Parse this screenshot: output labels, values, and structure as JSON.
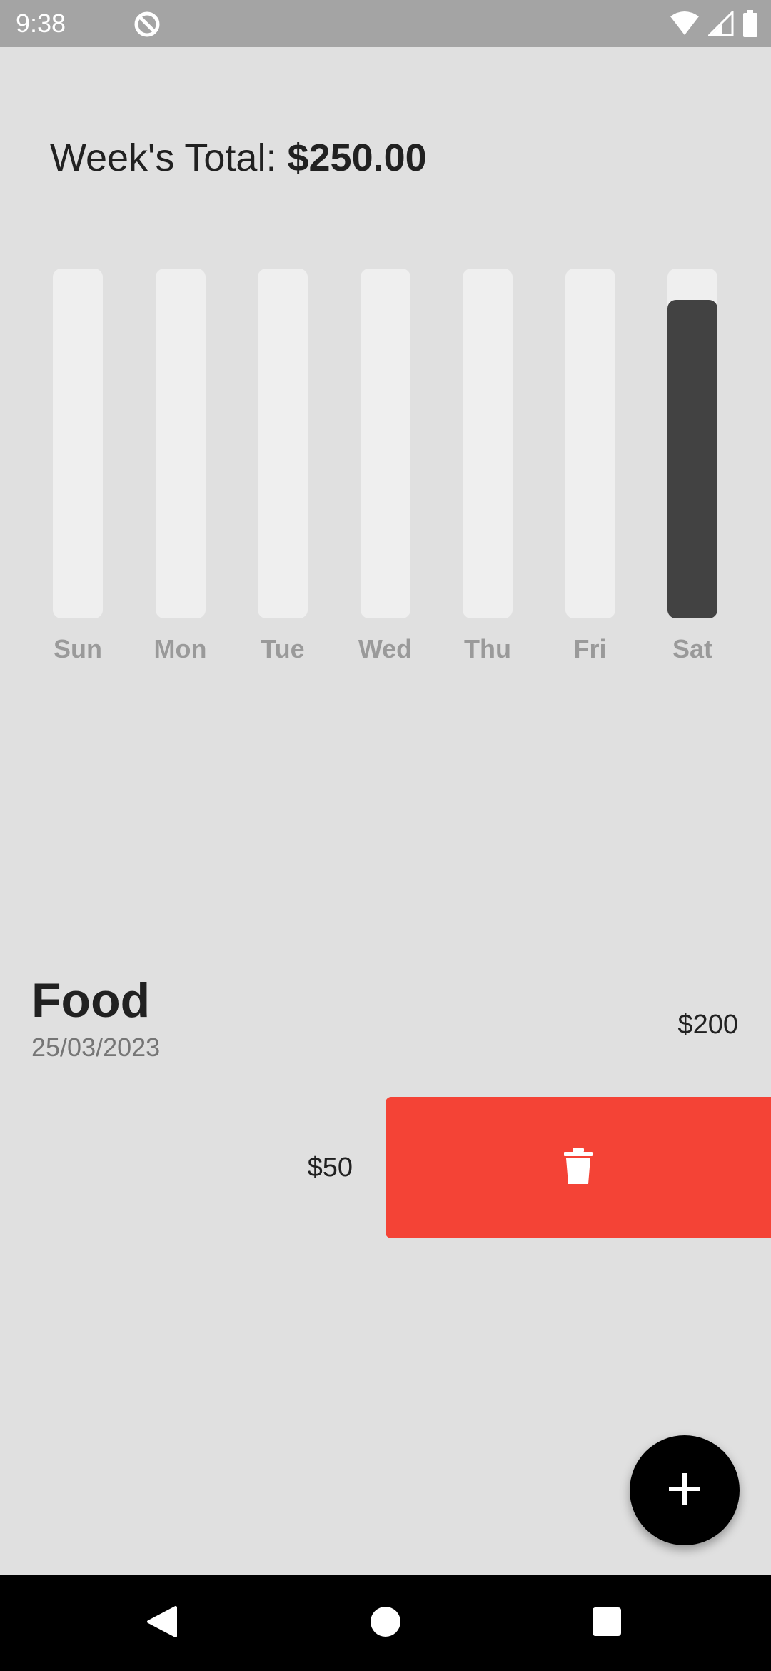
{
  "status_bar": {
    "time": "9:38",
    "icons": [
      "app-notification-icon",
      "wifi-icon",
      "cellular-signal-icon",
      "battery-icon"
    ]
  },
  "summary": {
    "label": "Week's Total: ",
    "amount": "$250.00"
  },
  "chart_data": {
    "type": "bar",
    "categories": [
      "Sun",
      "Mon",
      "Tue",
      "Wed",
      "Thu",
      "Fri",
      "Sat"
    ],
    "values": [
      0,
      0,
      0,
      0,
      0,
      0,
      250
    ],
    "fractions": [
      0,
      0,
      0,
      0,
      0,
      0,
      0.91
    ],
    "bar_color": "#424242",
    "track_color": "#efefef",
    "label_color": "#9a9a9a"
  },
  "expenses": [
    {
      "title": "Food",
      "date": "25/03/2023",
      "amount": "$200"
    },
    {
      "title": "",
      "date": "",
      "amount": "$50"
    }
  ],
  "swipe_action": {
    "icon": "trash-icon",
    "color": "#f44336"
  },
  "fab": {
    "icon": "plus-icon"
  },
  "nav_bar": {
    "icons": [
      "back-icon",
      "home-icon",
      "recents-icon"
    ]
  }
}
